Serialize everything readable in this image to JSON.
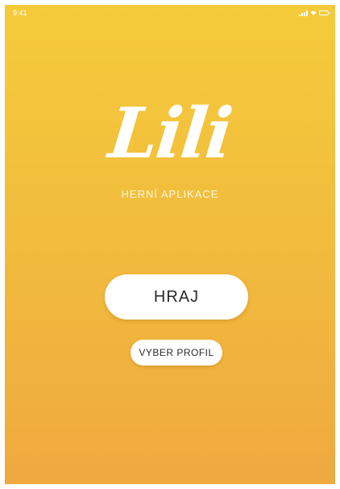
{
  "status_bar": {
    "time": "9:41"
  },
  "icons": {
    "signal": "signal-icon",
    "wifi": "wifi-icon",
    "battery": "battery-icon"
  },
  "colors": {
    "background_top": "#f5cb3a",
    "background_bottom": "#efa93f",
    "button_background": "#ffffff",
    "button_text": "#2a2a2a",
    "logo_text": "#ffffff"
  },
  "app": {
    "logo_text": "Lili",
    "subtitle": "HERNÍ APLIKACE"
  },
  "actions": {
    "play_label": "HRAJ",
    "select_profile_label": "VYBER PROFIL"
  }
}
